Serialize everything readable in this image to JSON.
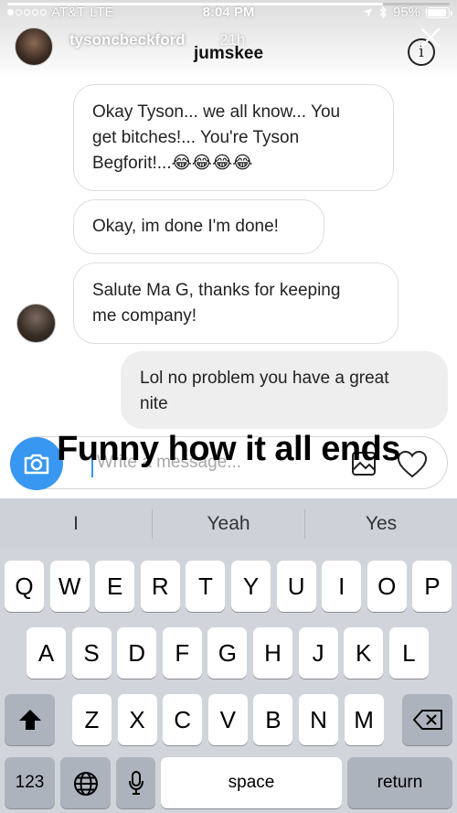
{
  "status_bar": {
    "carrier": "AT&T",
    "network": "LTE",
    "time": "8:04 PM",
    "battery": "95%",
    "battery_level": 0.95,
    "signal_bars": 1
  },
  "story": {
    "username": "tysoncbeckford",
    "time_ago": "21h",
    "progress": 0.85
  },
  "chat": {
    "title": "jumskee",
    "messages": [
      {
        "sender": "them",
        "lines": [
          "Okay Tyson... we all know... You",
          "get bitches!... You're Tyson",
          "Begforit!...😂😂😂😂"
        ]
      },
      {
        "sender": "them",
        "lines": [
          "Okay, im done I'm done!"
        ]
      },
      {
        "sender": "them",
        "lines": [
          "Salute Ma G, thanks for keeping",
          "me company!"
        ]
      },
      {
        "sender": "me",
        "lines": [
          "Lol no problem you have a great",
          "nite"
        ]
      }
    ],
    "composer_placeholder": "Write a message...",
    "overlay_caption": "Funny how it all ends"
  },
  "keyboard": {
    "predictions": [
      "I",
      "Yeah",
      "Yes"
    ],
    "row1": [
      "Q",
      "W",
      "E",
      "R",
      "T",
      "Y",
      "U",
      "I",
      "O",
      "P"
    ],
    "row2": [
      "A",
      "S",
      "D",
      "F",
      "G",
      "H",
      "J",
      "K",
      "L"
    ],
    "row3": [
      "Z",
      "X",
      "C",
      "V",
      "B",
      "N",
      "M"
    ],
    "numbers_key": "123",
    "space_key": "space",
    "return_key": "return"
  },
  "colors": {
    "accent": "#3897f0",
    "keyboard_bg": "#d1d5db"
  }
}
